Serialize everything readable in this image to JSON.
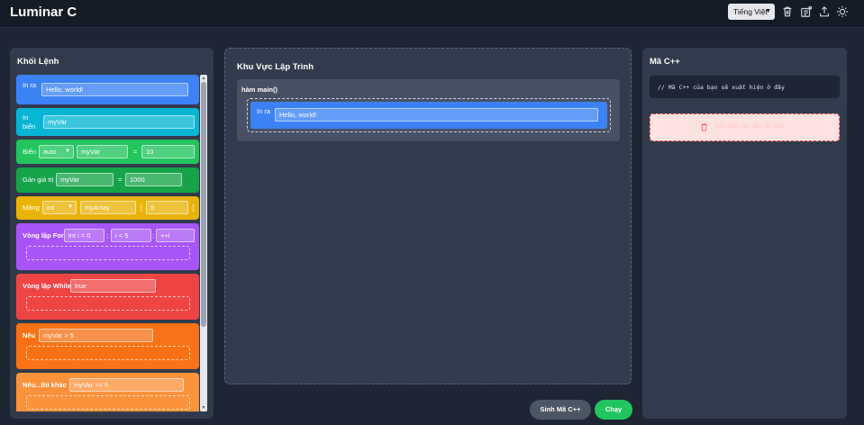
{
  "app": {
    "title": "Luminar C"
  },
  "header": {
    "language_selected": "Tiếng Việt",
    "icons": [
      "trash-icon",
      "edit-settings-icon",
      "export-icon",
      "sun-icon"
    ]
  },
  "palette": {
    "title": "Khối Lệnh",
    "blocks": {
      "print": {
        "label": "In ra",
        "value": "Hello, world!"
      },
      "input": {
        "label": "In biến",
        "value": "myVar"
      },
      "variable": {
        "label": "Biến",
        "type": "auto",
        "name": "myVar",
        "equals": "=",
        "value": "10"
      },
      "assign": {
        "label": "Gán giá trị",
        "name": "myVar",
        "equals": "=",
        "value": "1000"
      },
      "array": {
        "label": "Mảng",
        "type": "int",
        "name": "myArray",
        "open": "[",
        "size": "5",
        "close": "]"
      },
      "for_loop": {
        "label": "Vòng lặp For",
        "init": "int i = 0",
        "sep1": ";",
        "cond": "i < 5",
        "sep2": ";",
        "step": "++i"
      },
      "while_loop": {
        "label": "Vòng lặp While",
        "cond": "true"
      },
      "if": {
        "label": "Nếu",
        "cond": "myVar > 5"
      },
      "if_else": {
        "label": "Nếu...thì khác",
        "cond": "myVar == 5"
      }
    }
  },
  "workspace": {
    "title": "Khu Vực Lập Trình",
    "main_function": "hàm main()",
    "block": {
      "label": "In ra",
      "value": "Hello, world!"
    }
  },
  "code_panel": {
    "title": "Mã C++",
    "placeholder": "// Mã C++ của bạn sẽ xuất hiện ở đây",
    "trash_text": "Kéo khối vào đây để xóa"
  },
  "buttons": {
    "generate": "Sinh Mã C++",
    "run": "Chạy"
  },
  "colors": {
    "print": "#3b82f6",
    "input": "#06b6d4",
    "variable": "#22c55e",
    "assign": "#16a34a",
    "array": "#eab308",
    "for": "#a855f7",
    "while": "#ef4444",
    "if": "#f97316",
    "if_else": "#fb923c",
    "run": "#22c55e",
    "generate": "#4b5563"
  }
}
